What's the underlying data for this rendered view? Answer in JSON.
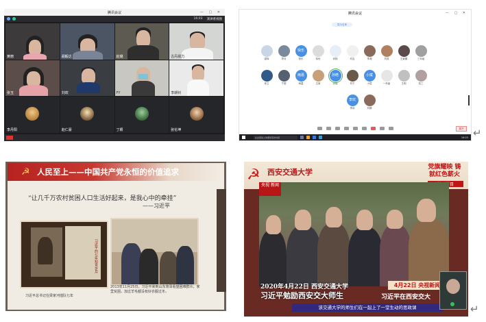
{
  "panel1": {
    "window_title": "腾讯会议",
    "toolbar_time": "16:03",
    "toolbar_view_label": "演讲者视图",
    "participants": [
      {
        "name": "黄丽"
      },
      {
        "name": "胡毅达"
      },
      {
        "name": "赵璐"
      },
      {
        "name": "古丹晨力"
      },
      {
        "name": "张玉"
      },
      {
        "name": "刘欢"
      },
      {
        "name": "FY"
      },
      {
        "name": "李朗钊"
      },
      {
        "name": "李丹阳"
      },
      {
        "name": "赵仁豪"
      },
      {
        "name": "丁颖"
      },
      {
        "name": "张伦坤"
      }
    ]
  },
  "panel2": {
    "window_title": "腾讯会议",
    "pill_label": "显示名单",
    "people": [
      {
        "label": "梁辉",
        "text": ""
      },
      {
        "label": "李月",
        "text": ""
      },
      {
        "label": "快乐",
        "text": "快乐"
      },
      {
        "label": "伟世",
        "text": ""
      },
      {
        "label": "何杨",
        "text": ""
      },
      {
        "label": "刘吉",
        "text": ""
      },
      {
        "label": "李湘",
        "text": ""
      },
      {
        "label": "刘奕",
        "text": ""
      },
      {
        "label": "王景娜",
        "text": ""
      },
      {
        "label": "三年级",
        "text": ""
      },
      {
        "label": "",
        "text": ""
      },
      {
        "label": "宋立",
        "text": ""
      },
      {
        "label": "宁丽",
        "text": ""
      },
      {
        "label": "雨嘉",
        "text": "雨嘉"
      },
      {
        "label": "王家",
        "text": ""
      },
      {
        "label": "孙皓",
        "text": "孙皓"
      },
      {
        "label": "刘宁",
        "text": ""
      },
      {
        "label": "小斌",
        "text": "小斌"
      },
      {
        "label": "一年级",
        "text": ""
      },
      {
        "label": "王明",
        "text": ""
      },
      {
        "label": "张三",
        "text": ""
      },
      {
        "label": "",
        "text": ""
      },
      {
        "label": "",
        "text": ""
      },
      {
        "label": "",
        "text": ""
      },
      {
        "label": "",
        "text": ""
      },
      {
        "label": "",
        "text": ""
      },
      {
        "label": "",
        "text": ""
      },
      {
        "label": "李欢",
        "text": "李欢"
      },
      {
        "label": "刘静",
        "text": ""
      }
    ],
    "leave_label": "离开",
    "search_placeholder": "在这里输入你要搜索的内容",
    "taskbar_time": "16:03"
  },
  "panel3": {
    "title": "人民至上——中国共产党永恒的价值追求",
    "quote": "“让几千万农村贫困人口生活好起来，是我心中的牵挂”",
    "attribution": "——习近平",
    "book_vertical_text": "习近平的七年知青岁月",
    "caption_left": "习近平总书记在梁家河插队七年",
    "caption_right": "2013年11月25日，习近平来到山东菏泽看望困难群众，家里贫困，加过羊毛都没有好衣服过冬。"
  },
  "panel4": {
    "logo_text": "西安交通大学",
    "red_title": "党旗耀映 铸就红色薪火",
    "special_label": "特别节目",
    "badge_text": "央视 新闻",
    "headline_line1": "2020年4月22日 西安交通大学",
    "headline_line2": "习近平勉励西安交大师生",
    "date_label": "4月22日 央视新闻",
    "news_line": "习近平在西安交大",
    "subtitle": "该交通大学的师生们在一起上了一堂生动的思政课"
  }
}
